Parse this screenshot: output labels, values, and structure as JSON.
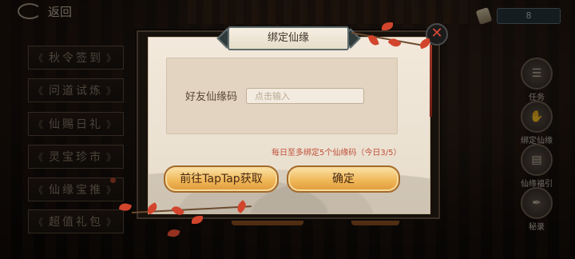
{
  "header": {
    "back_label": "返回",
    "resource_value": "8"
  },
  "menu": {
    "items": [
      "秋令签到",
      "问道试炼",
      "仙赐日礼",
      "灵宝珍市",
      "仙缘宝推",
      "超值礼包"
    ]
  },
  "side_buttons": [
    "任务",
    "绑定仙缘",
    "仙缘福引",
    "秘录"
  ],
  "dialog": {
    "title": "绑定仙缘",
    "field_label": "好友仙缘码",
    "input_placeholder": "点击输入",
    "limit_text": "每日至多绑定5个仙缘码（今日3/5）",
    "primary_button": "前往TapTap获取",
    "confirm_button": "确定",
    "close_glyph": "✕"
  },
  "colors": {
    "accent": "#f0b85a",
    "warning_text": "#c0503a",
    "leaf": "#d2452c"
  }
}
